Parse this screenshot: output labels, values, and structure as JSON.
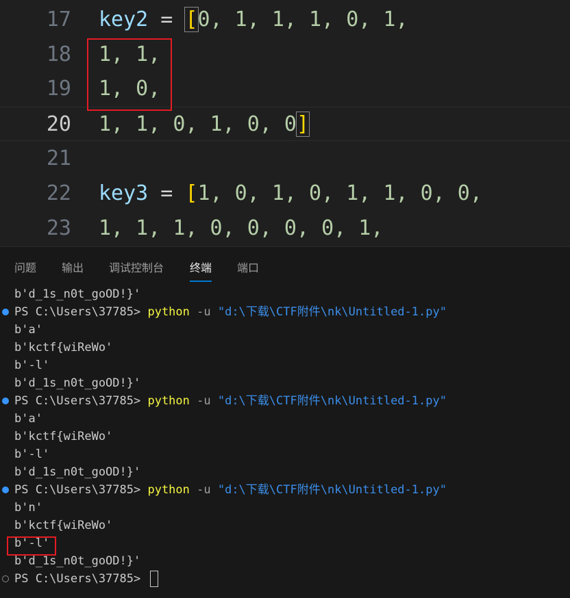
{
  "editor": {
    "lines": [
      {
        "num": "17",
        "key": "key2",
        "eq": " = ",
        "open": "[",
        "items": "0, 1, 1, 1, 0, 1,"
      },
      {
        "num": "18",
        "text": "1, 1,"
      },
      {
        "num": "19",
        "text": "1, 0,"
      },
      {
        "num": "20",
        "text": "1, 1, 0, 1, 0, 0",
        "close": "]"
      },
      {
        "num": "21",
        "text": ""
      },
      {
        "num": "22",
        "key": "key3",
        "eq": " = ",
        "open": "[",
        "items": "1, 0, 1, 0, 1, 1, 0, 0,"
      },
      {
        "num": "23",
        "text": "1, 1, 1, 0, 0, 0, 0, 1,"
      }
    ]
  },
  "panel": {
    "tabs": [
      "问题",
      "输出",
      "调试控制台",
      "终端",
      "端口"
    ],
    "active_tab": "终端"
  },
  "terminal": {
    "prompt": "PS C:\\Users\\37785> ",
    "cmd": "python",
    "flag": " -u ",
    "path": "\"d:\\下载\\CTF附件\\nk\\Untitled-1.py\"",
    "lines": [
      "b'd_1s_n0t_goOD!}'",
      "b'a'",
      "b'kctf{wiReWo'",
      "b'-l'",
      "b'd_1s_n0t_goOD!}'",
      "b'a'",
      "b'kctf{wiReWo'",
      "b'-l'",
      "b'd_1s_n0t_goOD!}'",
      "b'n'",
      "b'kctf{wiReWo'",
      "b'-l'",
      "b'd_1s_n0t_goOD!}'"
    ]
  },
  "colors": {
    "bracket": "#ffd700",
    "annotation_box": "#e51c23",
    "command": "#f5f543",
    "string": "#3b8eea",
    "prompt_dot": "#3794ff"
  }
}
